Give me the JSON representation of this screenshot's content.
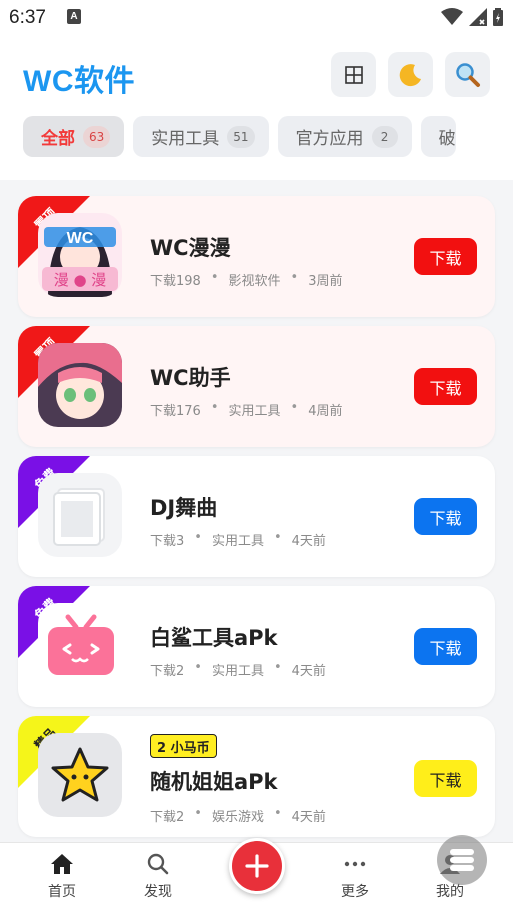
{
  "status_bar": {
    "time": "6:37",
    "notification_glyph": "A"
  },
  "header": {
    "title": "WC软件",
    "buttons": [
      "grid-icon",
      "moon-icon",
      "search-icon"
    ]
  },
  "tabs": [
    {
      "label": "全部",
      "count": "63",
      "active": true
    },
    {
      "label": "实用工具",
      "count": "51",
      "active": false
    },
    {
      "label": "官方应用",
      "count": "2",
      "active": false
    },
    {
      "label": "破",
      "count": "",
      "active": false
    }
  ],
  "apps": [
    {
      "name": "WC漫漫",
      "tag": "置顶",
      "tag_color": "#f01818",
      "downloads": "下载198",
      "category": "影视软件",
      "time": "3周前",
      "button": "下载",
      "button_color": "#f21010",
      "coin": ""
    },
    {
      "name": "WC助手",
      "tag": "置顶",
      "tag_color": "#f01818",
      "downloads": "下载176",
      "category": "实用工具",
      "time": "4周前",
      "button": "下载",
      "button_color": "#f21010",
      "coin": ""
    },
    {
      "name": "DJ舞曲",
      "tag": "免费",
      "tag_color": "#7a10e6",
      "downloads": "下载3",
      "category": "实用工具",
      "time": "4天前",
      "button": "下载",
      "button_color": "#0c74f0",
      "coin": ""
    },
    {
      "name": "白鲨工具aPk",
      "tag": "免费",
      "tag_color": "#7a10e6",
      "downloads": "下载2",
      "category": "实用工具",
      "time": "4天前",
      "button": "下载",
      "button_color": "#0c74f0",
      "coin": ""
    },
    {
      "name": "随机姐姐aPk",
      "tag": "精品",
      "tag_color": "#f5f51a",
      "downloads": "下载2",
      "category": "娱乐游戏",
      "time": "4天前",
      "button": "下载",
      "button_color": "#ffee1a",
      "coin": "2 小马币"
    }
  ],
  "bottom_nav": {
    "home": "首页",
    "discover": "发现",
    "add": "+",
    "more": "更多",
    "mine": "我的"
  }
}
